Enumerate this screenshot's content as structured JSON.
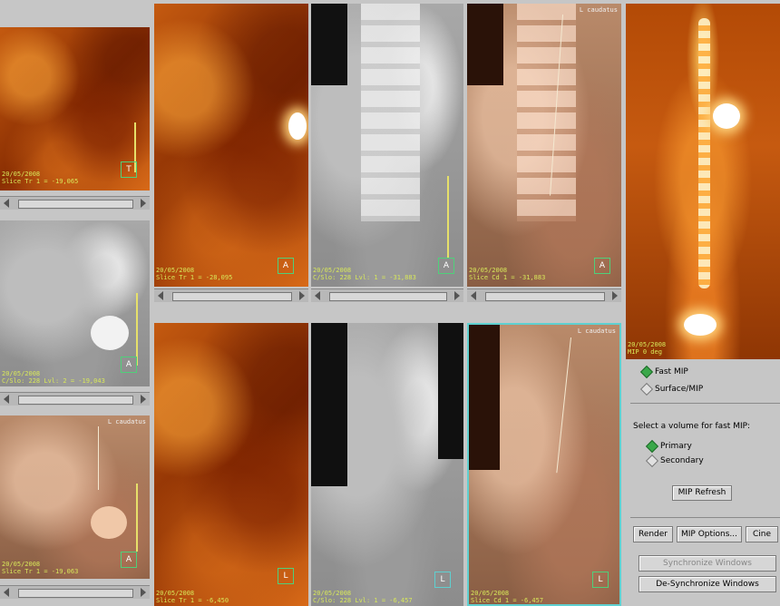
{
  "viewports": {
    "left_top": {
      "date": "20/05/2008",
      "slice": "Slice Tr 1 = -19,065",
      "orient": "T"
    },
    "left_mid": {
      "date": "20/05/2008",
      "slice": "C/Slo: 228 Lvl: 2 = -19,043",
      "orient": "A"
    },
    "left_bot": {
      "date": "20/05/2008",
      "slice": "Slice Tr 1 = -19,063",
      "orient": "A",
      "label": "L caudatus"
    },
    "col1_top": {
      "date": "20/05/2008",
      "slice": "Slice Tr 1 = -28,095",
      "orient": "A"
    },
    "col2_top": {
      "date": "20/05/2008",
      "slice": "C/Slo: 228 Lvl: 1 = -31,883",
      "orient": "A"
    },
    "col3_top": {
      "date": "20/05/2008",
      "slice": "Slice Cd 1 = -31,883",
      "orient": "A",
      "label": "L caudatus"
    },
    "col1_bot": {
      "date": "20/05/2008",
      "slice": "Slice Tr 1 = -6,450",
      "orient": "L"
    },
    "col2_bot": {
      "date": "20/05/2008",
      "slice": "C/Slo: 228 Lvl: 1 = -6,457",
      "orient": "L"
    },
    "col3_bot": {
      "date": "20/05/2008",
      "slice": "Slice Cd 1 = -6,457",
      "orient": "L",
      "label": "L caudatus"
    },
    "mip": {
      "date": "20/05/2008",
      "slice": "MIP 0 deg"
    }
  },
  "controls": {
    "render_modes": [
      {
        "label": "Fast MIP",
        "selected": true
      },
      {
        "label": "Surface/MIP",
        "selected": false
      }
    ],
    "volume_prompt": "Select a volume for fast MIP:",
    "volumes": [
      {
        "label": "Primary",
        "selected": true
      },
      {
        "label": "Secondary",
        "selected": false
      }
    ],
    "mip_refresh": "MIP Refresh",
    "render": "Render",
    "mip_options": "MIP Options...",
    "cine": "Cine",
    "synchronize": "Synchronize Windows",
    "desynchronize": "De-Synchronize Windows"
  },
  "colors": {
    "accent_green": "#3aa84a",
    "selection_border": "#5fd0d0",
    "overlay_text": "#d8e85a"
  }
}
